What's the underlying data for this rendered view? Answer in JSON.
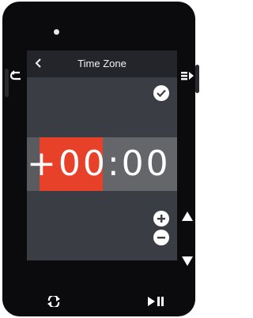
{
  "screen": {
    "title": "Time Zone",
    "time_zone_value": "+00:00"
  },
  "icons": {
    "back": "chevron-left-icon",
    "confirm": "checkmark-icon",
    "increase": "plus-icon",
    "decrease": "minus-icon",
    "hw_back": "return-arrow-icon",
    "hw_menu": "menu-arrow-icon",
    "hw_up": "triangle-up-icon",
    "hw_down": "triangle-down-icon",
    "hw_lap": "loop-arrows-icon",
    "hw_start_pause": "play-pause-icon"
  },
  "colors": {
    "highlight": "#e8412a",
    "screen_bg": "#3b3d45",
    "header_bg": "#24252b",
    "band": "#65666a",
    "device": "#0b0b0d"
  }
}
